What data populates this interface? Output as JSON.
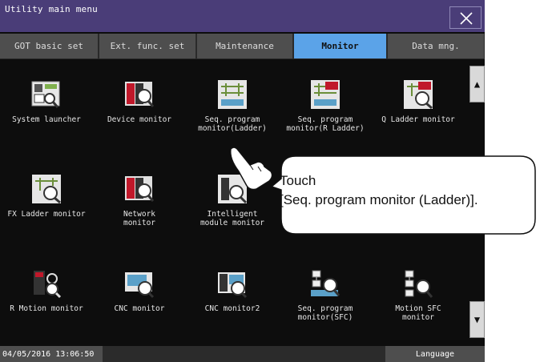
{
  "window": {
    "title": "Utility main menu"
  },
  "tabs": [
    {
      "label": "GOT basic set",
      "active": false
    },
    {
      "label": "Ext. func. set",
      "active": false
    },
    {
      "label": "Maintenance",
      "active": false
    },
    {
      "label": "Monitor",
      "active": true
    },
    {
      "label": "Data mng.",
      "active": false
    }
  ],
  "apps": [
    {
      "label": "System launcher",
      "icon": "system-launcher-icon"
    },
    {
      "label": "Device monitor",
      "icon": "device-monitor-icon"
    },
    {
      "label": "Seq. program\nmonitor(Ladder)",
      "icon": "seq-ladder-icon"
    },
    {
      "label": "Seq. program\nmonitor(R Ladder)",
      "icon": "seq-r-ladder-icon"
    },
    {
      "label": "Q Ladder monitor",
      "icon": "q-ladder-icon"
    },
    {
      "label": "FX Ladder monitor",
      "icon": "fx-ladder-icon"
    },
    {
      "label": "Network\nmonitor",
      "icon": "network-monitor-icon"
    },
    {
      "label": "Intelligent\nmodule monitor",
      "icon": "intelligent-module-icon"
    },
    {
      "label": "R Motion monitor",
      "icon": "r-motion-icon"
    },
    {
      "label": "CNC monitor",
      "icon": "cnc-monitor-icon"
    },
    {
      "label": "CNC monitor2",
      "icon": "cnc-monitor2-icon"
    },
    {
      "label": "Seq. program\nmonitor(SFC)",
      "icon": "seq-sfc-icon"
    },
    {
      "label": "Motion SFC\nmonitor",
      "icon": "motion-sfc-icon"
    }
  ],
  "scroll": {
    "up": "▲",
    "down": "▼"
  },
  "status": {
    "clock": "04/05/2016 13:06:50",
    "language": "Language"
  },
  "callout": {
    "text": "Touch\n[Seq. program monitor (Ladder)]."
  },
  "colors": {
    "accent": "#5ba3e8",
    "titlebar": "#4a3d78",
    "background": "#0d0d0d"
  }
}
